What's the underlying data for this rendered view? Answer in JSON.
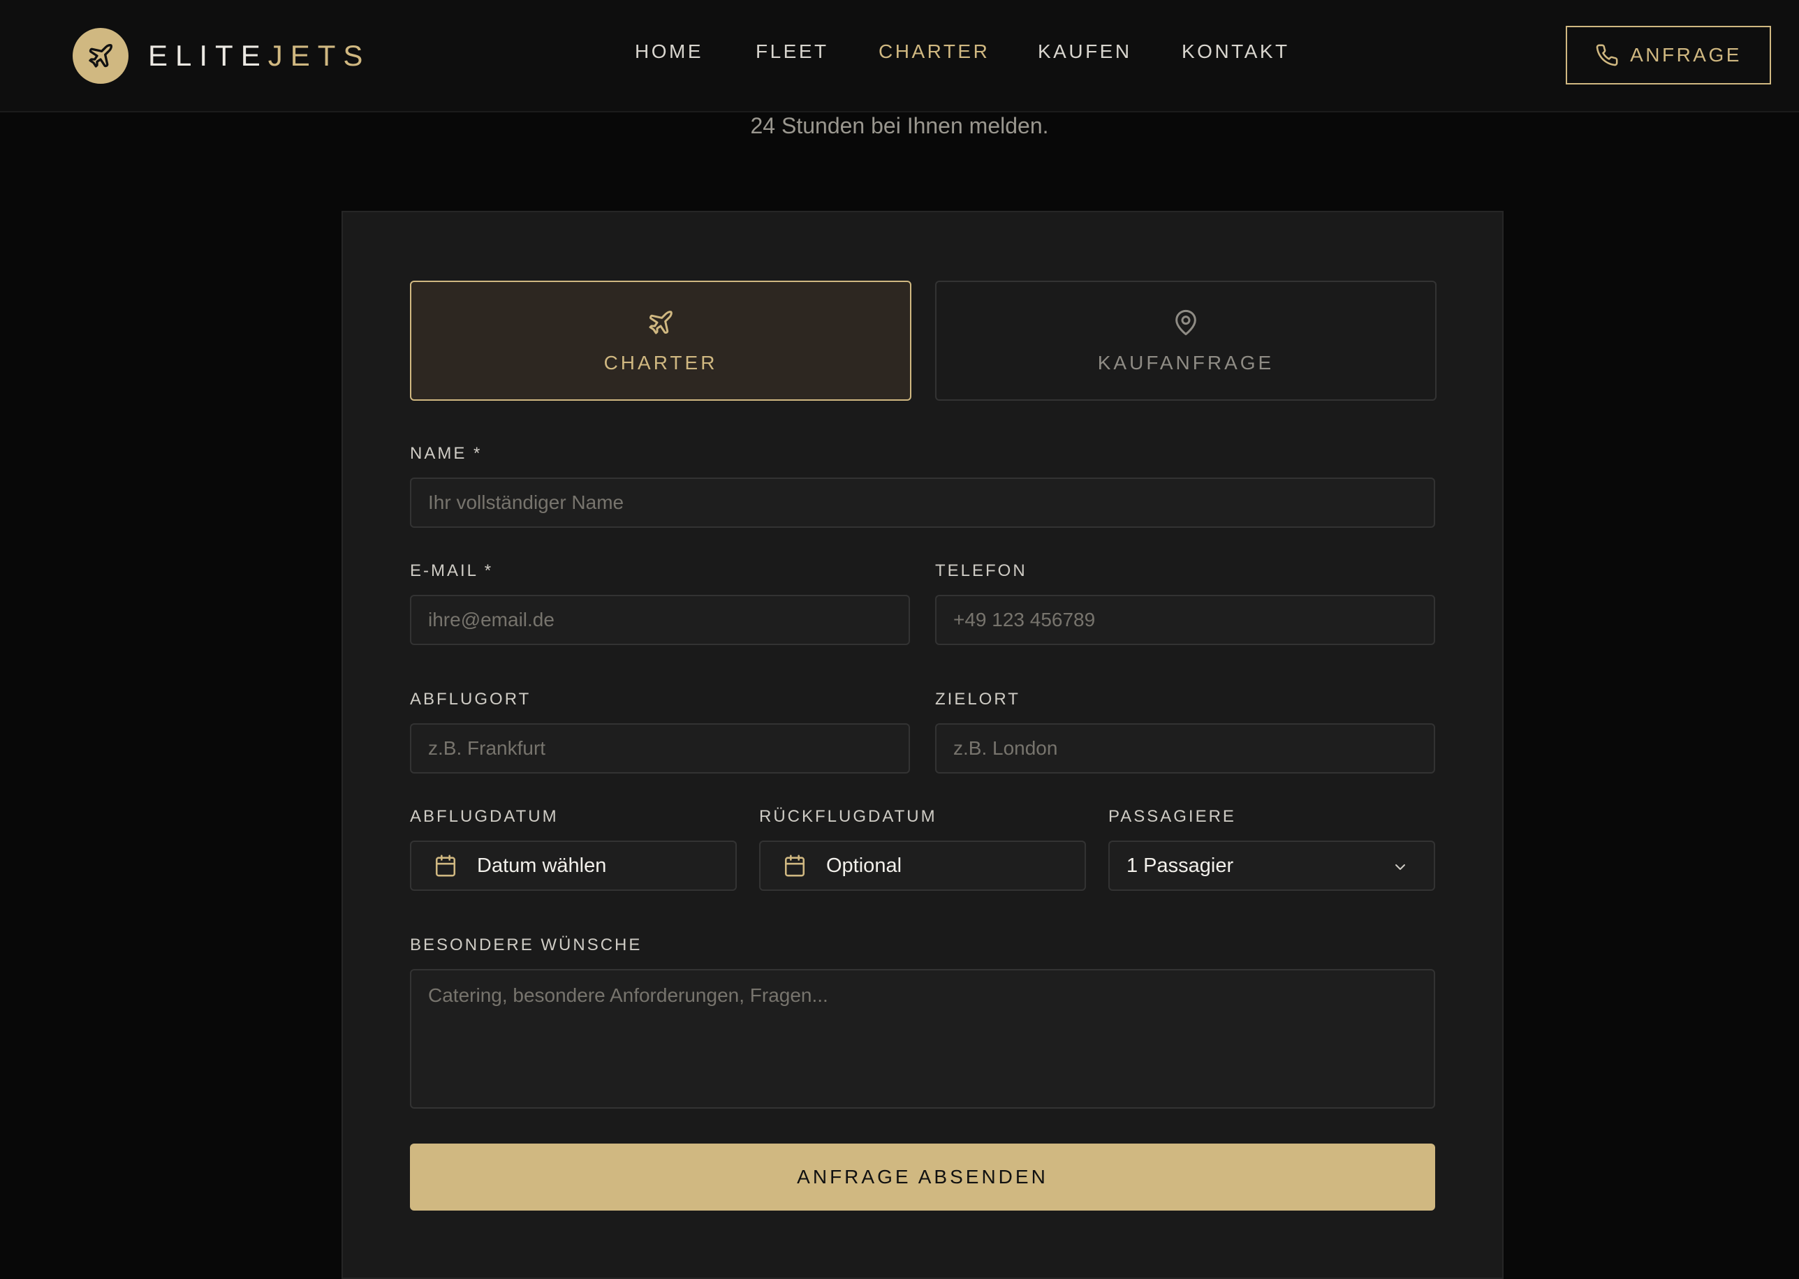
{
  "brand": {
    "name_part1": "ELITE",
    "name_part2": "JETS",
    "logo_icon": "plane-icon"
  },
  "nav": {
    "items": [
      {
        "label": "HOME",
        "active": false
      },
      {
        "label": "FLEET",
        "active": false
      },
      {
        "label": "CHARTER",
        "active": true
      },
      {
        "label": "KAUFEN",
        "active": false
      },
      {
        "label": "KONTAKT",
        "active": false
      }
    ],
    "cta_label": "ANFRAGE",
    "cta_icon": "phone-icon"
  },
  "hero": {
    "subtitle": "24 Stunden bei Ihnen melden."
  },
  "form": {
    "tabs": [
      {
        "label": "CHARTER",
        "icon": "plane-icon",
        "active": true
      },
      {
        "label": "KAUFANFRAGE",
        "icon": "map-pin-icon",
        "active": false
      }
    ],
    "name": {
      "label": "NAME *",
      "placeholder": "Ihr vollständiger Name",
      "value": ""
    },
    "email": {
      "label": "E-MAIL *",
      "placeholder": "ihre@email.de",
      "value": ""
    },
    "phone": {
      "label": "TELEFON",
      "placeholder": "+49 123 456789",
      "value": ""
    },
    "departure": {
      "label": "ABFLUGORT",
      "placeholder": "z.B. Frankfurt",
      "value": ""
    },
    "destination": {
      "label": "ZIELORT",
      "placeholder": "z.B. London",
      "value": ""
    },
    "departure_date": {
      "label": "ABFLUGDATUM",
      "value": "Datum wählen",
      "icon": "calendar-icon"
    },
    "return_date": {
      "label": "RÜCKFLUGDATUM",
      "value": "Optional",
      "icon": "calendar-icon"
    },
    "passengers": {
      "label": "PASSAGIERE",
      "value": "1 Passagier",
      "icon": "chevron-down-icon"
    },
    "wishes": {
      "label": "BESONDERE WÜNSCHE",
      "placeholder": "Catering, besondere Anforderungen, Fragen...",
      "value": ""
    },
    "submit_label": "ANFRAGE ABSENDEN"
  },
  "colors": {
    "accent": "#d0b881",
    "background": "#080808",
    "card": "#1a1a1a",
    "border": "#333333"
  }
}
